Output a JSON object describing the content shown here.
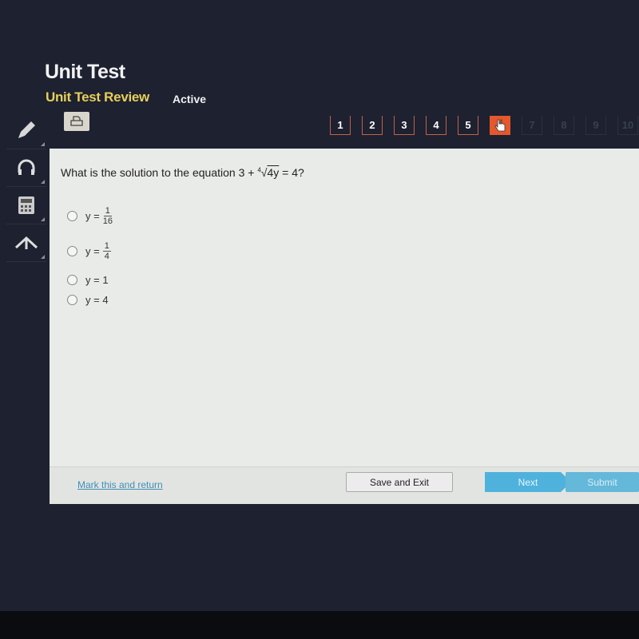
{
  "header": {
    "title": "Unit Test",
    "subtitle": "Unit Test Review",
    "status": "Active"
  },
  "toolbar": {
    "icons": [
      "print-icon",
      "pencil-icon",
      "headphones-icon",
      "calculator-icon",
      "arrow-up-icon"
    ]
  },
  "question_nav": {
    "items": [
      "1",
      "2",
      "3",
      "4",
      "5",
      "6",
      "7",
      "8",
      "9",
      "10"
    ],
    "current": "6",
    "accent": "#e4582c"
  },
  "question": {
    "prefix": "What is the solution to the equation 3 + ",
    "root_index": "4",
    "radicand": "4y",
    "suffix": " = 4?"
  },
  "options": [
    {
      "lhs": "y =",
      "num": "1",
      "den": "16"
    },
    {
      "lhs": "y =",
      "num": "1",
      "den": "4"
    },
    {
      "label": "y = 1"
    },
    {
      "label": "y = 4"
    }
  ],
  "footer": {
    "mark_label": "Mark this and return",
    "save_label": "Save and Exit",
    "next_label": "Next",
    "submit_label": "Submit"
  }
}
